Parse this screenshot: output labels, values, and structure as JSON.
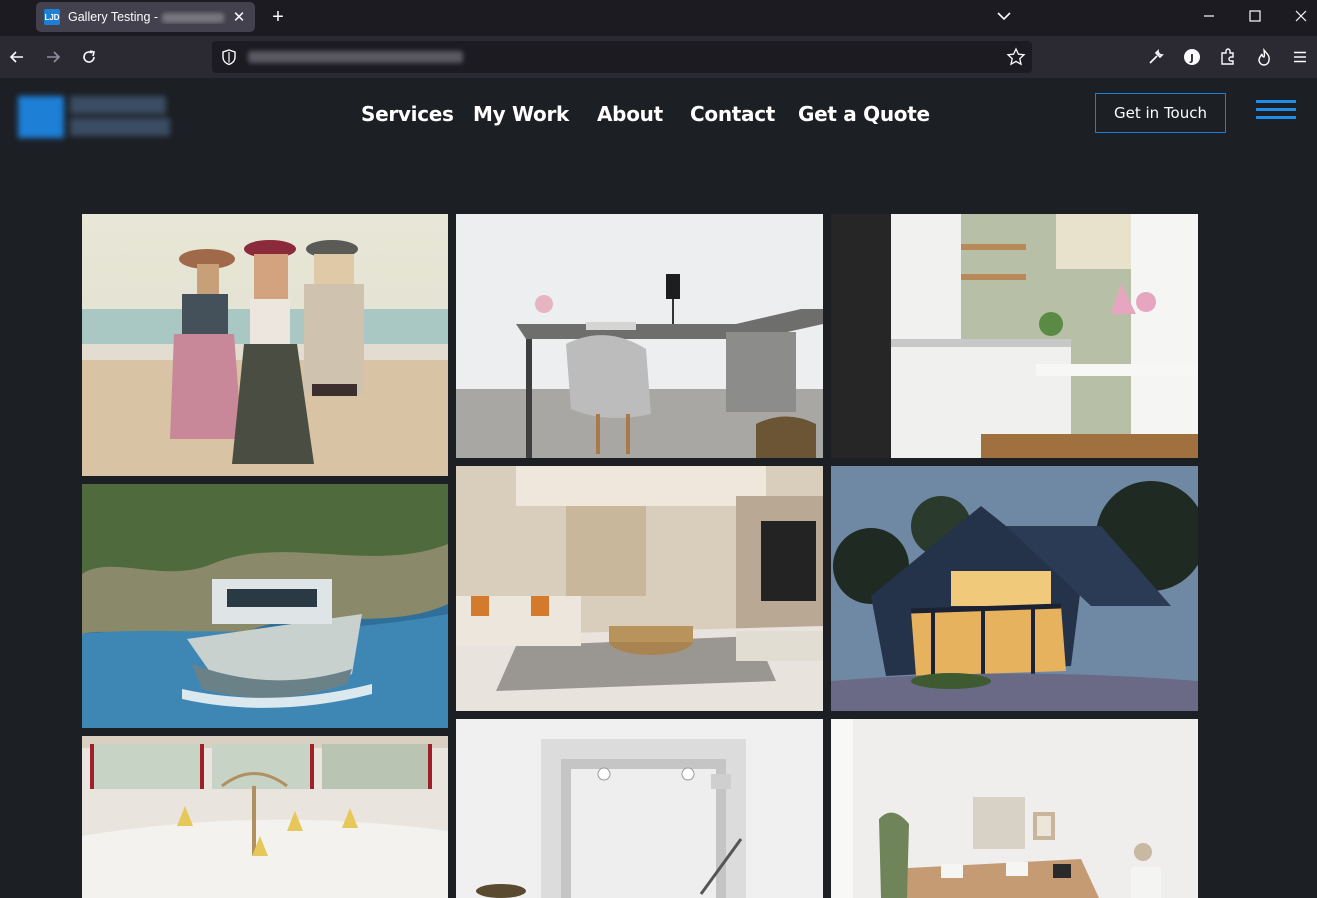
{
  "browser": {
    "tab_title": "Gallery Testing - ",
    "tab_favicon_text": "LJD",
    "close_tab_glyph": "✕",
    "new_tab_glyph": "+",
    "window_controls": [
      "minimize-icon",
      "maximize-icon",
      "close-icon"
    ],
    "nav_icons": [
      "back-arrow-icon",
      "forward-arrow-icon",
      "reload-icon"
    ],
    "toolbar_icons": [
      "wrench-icon",
      "account-icon",
      "extensions-icon",
      "fire-icon",
      "menu-icon"
    ]
  },
  "site": {
    "nav": [
      "Services",
      "My Work",
      "About",
      "Contact",
      "Get a Quote"
    ],
    "cta_label": "Get in Touch",
    "accent_color": "#1e7fd6"
  },
  "gallery": {
    "images": [
      {
        "subject": "women-at-beach"
      },
      {
        "subject": "office-desk-chair"
      },
      {
        "subject": "white-kitchen"
      },
      {
        "subject": "yacht-at-sea"
      },
      {
        "subject": "living-room-tv"
      },
      {
        "subject": "modern-house-night"
      },
      {
        "subject": "banquet-hall"
      },
      {
        "subject": "mirror-bathroom"
      },
      {
        "subject": "living-room-sofa"
      }
    ]
  }
}
